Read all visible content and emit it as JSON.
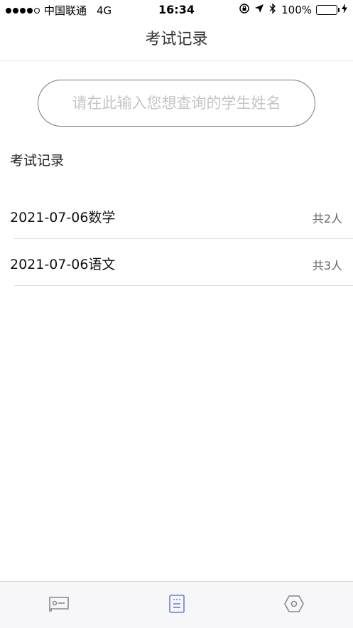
{
  "status_bar": {
    "carrier": "中国联通",
    "network": "4G",
    "time": "16:34",
    "battery": "100%",
    "battery_level": 1.0,
    "battery_color": "#4cd964"
  },
  "nav": {
    "title": "考试记录"
  },
  "search": {
    "placeholder": "请在此输入您想查询的学生姓名"
  },
  "section": {
    "title": "考试记录"
  },
  "records": [
    {
      "name": "2021-07-06数学",
      "count": "共2人"
    },
    {
      "name": "2021-07-06语文",
      "count": "共3人"
    }
  ],
  "tabs": [
    {
      "icon": "id-card-icon",
      "active": false
    },
    {
      "icon": "document-list-icon",
      "active": true
    },
    {
      "icon": "hexagon-settings-icon",
      "active": false
    }
  ],
  "colors": {
    "tab_active": "#6b7fd6",
    "tab_inactive": "#888888"
  }
}
